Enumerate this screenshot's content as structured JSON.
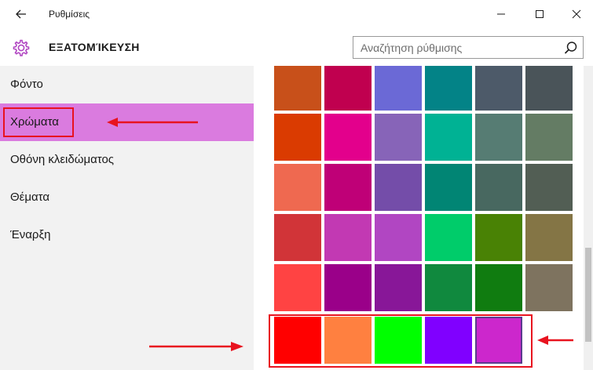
{
  "window": {
    "title": "Ρυθμίσεις"
  },
  "header": {
    "title": "ΕΞΑΤΟΜΊΚΕΥΣΗ",
    "search_placeholder": "Αναζήτηση ρύθμισης"
  },
  "sidebar": {
    "items": [
      {
        "label": "Φόντο"
      },
      {
        "label": "Χρώματα",
        "selected": true
      },
      {
        "label": "Οθόνη κλειδώματος"
      },
      {
        "label": "Θέματα"
      },
      {
        "label": "Έναρξη"
      }
    ]
  },
  "palette": {
    "rows": [
      [
        "#c8501a",
        "#c0004f",
        "#6b69d6",
        "#038387",
        "#4d5a69",
        "#4a5459"
      ],
      [
        "#da3b01",
        "#e3008c",
        "#8764b8",
        "#00b294",
        "#567c73",
        "#647c64"
      ],
      [
        "#ef6950",
        "#bf0077",
        "#744da9",
        "#018574",
        "#486860",
        "#525e54"
      ],
      [
        "#d13438",
        "#c239b3",
        "#b146c2",
        "#00cc6a",
        "#498205",
        "#847545"
      ],
      [
        "#ff4343",
        "#9a0089",
        "#881798",
        "#10893e",
        "#107c10",
        "#7e735f"
      ],
      [
        "#ff0000",
        "#ff8040",
        "#00ff00",
        "#8000ff",
        "#cc27cc"
      ]
    ],
    "selected": {
      "row": 5,
      "col": 4
    }
  },
  "annotations": {
    "color": "#e8131f"
  }
}
